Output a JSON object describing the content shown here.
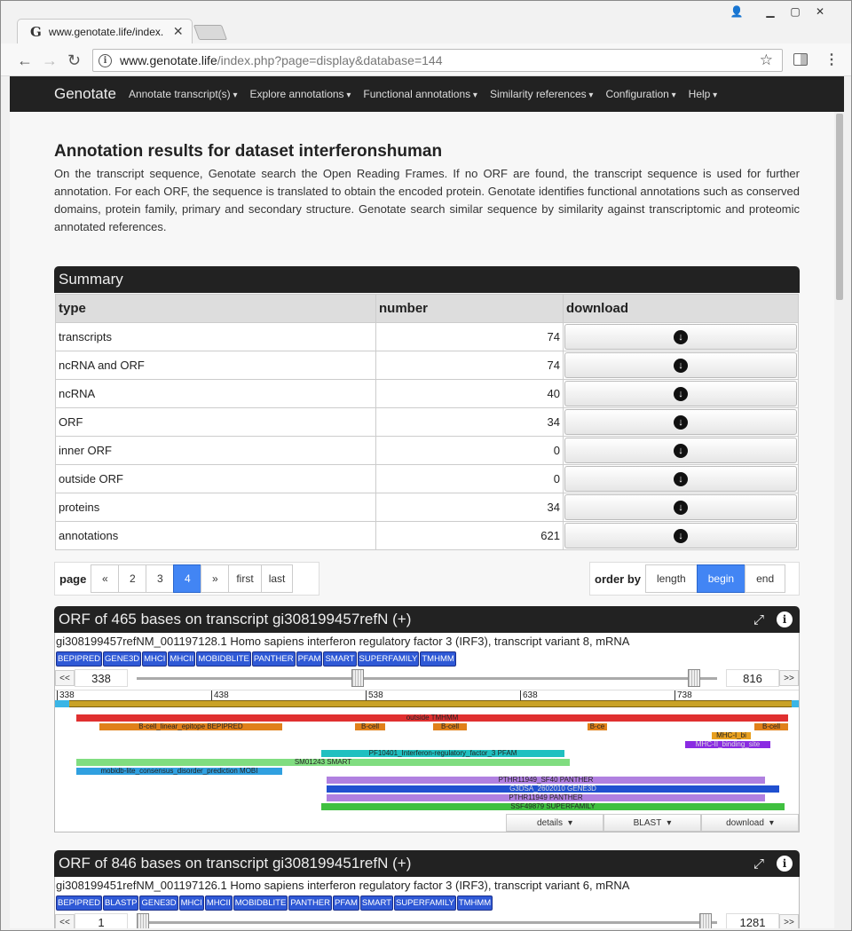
{
  "browser": {
    "tab_title": "www.genotate.life/index.",
    "url_host": "www.genotate.life",
    "url_path": "/index.php?page=display&database=144"
  },
  "navbar": {
    "brand": "Genotate",
    "menus": [
      "Annotate transcript(s)",
      "Explore annotations",
      "Functional annotations",
      "Similarity references",
      "Configuration",
      "Help"
    ]
  },
  "page": {
    "title": "Annotation results for dataset interferonshuman",
    "intro": "On the transcript sequence, Genotate search the Open Reading Frames. If no ORF are found, the transcript sequence is used for further annotation. For each ORF, the sequence is translated to obtain the encoded protein. Genotate identifies functional annotations such as conserved domains, protein family, primary and secondary structure. Genotate search similar sequence by similarity against transcriptomic and proteomic annotated references."
  },
  "summary": {
    "title": "Summary",
    "headers": [
      "type",
      "number",
      "download"
    ],
    "rows": [
      {
        "type": "transcripts",
        "number": "74"
      },
      {
        "type": "ncRNA and ORF",
        "number": "74"
      },
      {
        "type": "ncRNA",
        "number": "40"
      },
      {
        "type": "ORF",
        "number": "34"
      },
      {
        "type": "inner ORF",
        "number": "0"
      },
      {
        "type": "outside ORF",
        "number": "0"
      },
      {
        "type": "proteins",
        "number": "34"
      },
      {
        "type": "annotations",
        "number": "621"
      }
    ]
  },
  "pagination": {
    "label": "page",
    "prev": "«",
    "pages": [
      "2",
      "3",
      "4"
    ],
    "active": "4",
    "next": "»",
    "first": "first",
    "last": "last"
  },
  "order": {
    "label": "order by",
    "options": [
      "length",
      "begin",
      "end"
    ],
    "active": "begin"
  },
  "orfs": [
    {
      "title": "ORF of 465 bases on transcript gi308199457refN (+)",
      "description": "gi308199457refNM_001197128.1 Homo sapiens interferon regulatory factor 3 (IRF3), transcript variant 8, mRNA",
      "tags": [
        "BEPIPRED",
        "GENE3D",
        "MHCI",
        "MHCII",
        "MOBIDBLITE",
        "PANTHER",
        "PFAM",
        "SMART",
        "SUPERFAMILY",
        "TMHMM"
      ],
      "range_start": "338",
      "range_end": "816",
      "ruler": [
        "338",
        "438",
        "538",
        "638",
        "738"
      ],
      "features": [
        "outside TMHMM",
        "B-cell_linear_epitope BEPIPRED",
        "B-cell",
        "B-cell",
        "B-ce",
        "B-cell",
        "MHC-I_bi",
        "MHC-II_binding_site",
        "PF10401_Interferon-regulatory_factor_3 PFAM",
        "SM01243 SMART",
        "mobidb-lite_consensus_disorder_prediction MOBI",
        "PTHR11949_SF40 PANTHER",
        "G3DSA_2602010 GENE3D",
        "PTHR11949 PANTHER",
        "SSF49879 SUPERFAMILY"
      ],
      "buttons": [
        "details",
        "BLAST",
        "download"
      ]
    },
    {
      "title": "ORF of 846 bases on transcript gi308199451refN (+)",
      "description": "gi308199451refNM_001197126.1 Homo sapiens interferon regulatory factor 3 (IRF3), transcript variant 6, mRNA",
      "tags": [
        "BEPIPRED",
        "BLASTP",
        "GENE3D",
        "MHCI",
        "MHCII",
        "MOBIDBLITE",
        "PANTHER",
        "PFAM",
        "SMART",
        "SUPERFAMILY",
        "TMHMM"
      ],
      "range_start": "1",
      "range_end": "1281"
    }
  ]
}
